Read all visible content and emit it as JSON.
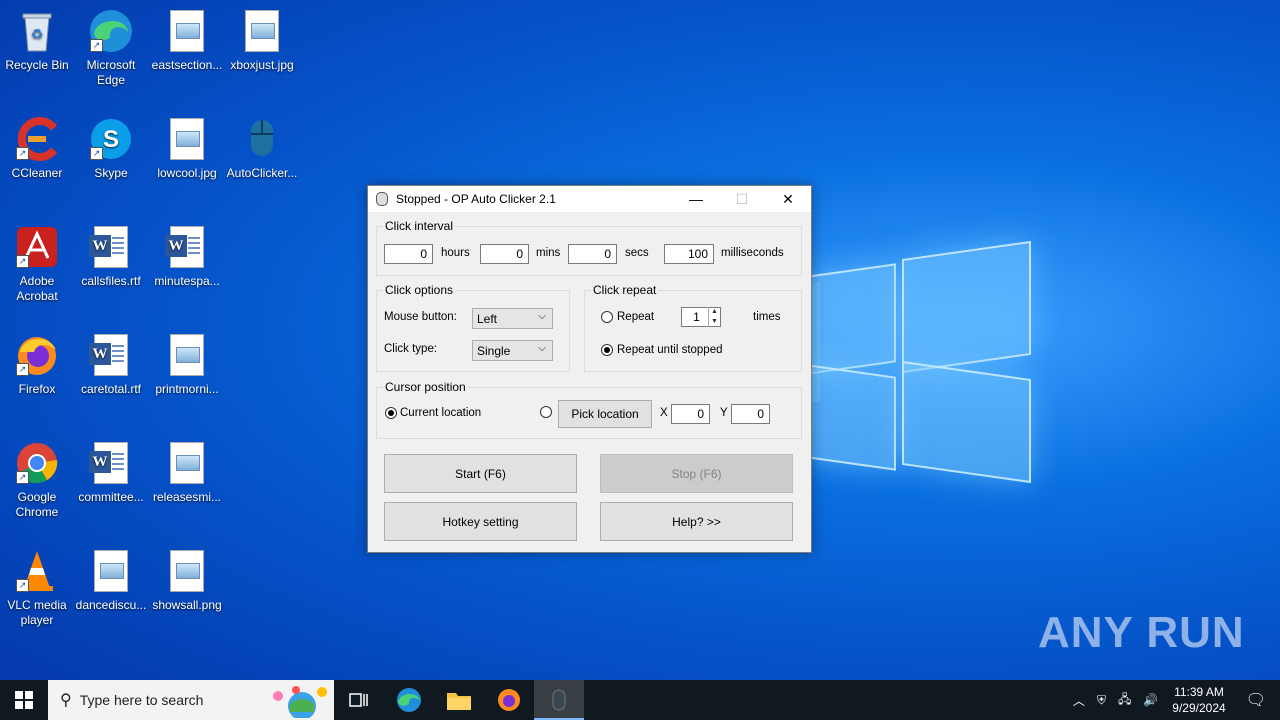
{
  "desktop": {
    "icons": [
      {
        "label": "Recycle Bin"
      },
      {
        "label": "Microsoft Edge"
      },
      {
        "label": "eastsection..."
      },
      {
        "label": "xboxjust.jpg"
      },
      {
        "label": "CCleaner"
      },
      {
        "label": "Skype"
      },
      {
        "label": "lowcool.jpg"
      },
      {
        "label": "AutoClicker..."
      },
      {
        "label": "Adobe Acrobat"
      },
      {
        "label": "callsfiles.rtf"
      },
      {
        "label": "minutespa..."
      },
      {
        "label": "Firefox"
      },
      {
        "label": "caretotal.rtf"
      },
      {
        "label": "printmorni..."
      },
      {
        "label": "Google Chrome"
      },
      {
        "label": "committee..."
      },
      {
        "label": "releasesmi..."
      },
      {
        "label": "VLC media player"
      },
      {
        "label": "dancediscu..."
      },
      {
        "label": "showsall.png"
      }
    ]
  },
  "window": {
    "title": "Stopped - OP Auto Clicker 2.1",
    "click_interval": {
      "label": "Click interval",
      "hours": "0",
      "hours_label": "hours",
      "mins": "0",
      "mins_label": "mins",
      "secs": "0",
      "secs_label": "secs",
      "ms": "100",
      "ms_label": "milliseconds"
    },
    "click_options": {
      "label": "Click options",
      "mouse_button_label": "Mouse button:",
      "mouse_button_value": "Left",
      "click_type_label": "Click type:",
      "click_type_value": "Single"
    },
    "click_repeat": {
      "label": "Click repeat",
      "repeat_label": "Repeat",
      "repeat_count": "1",
      "times_label": "times",
      "until_stopped_label": "Repeat until stopped",
      "selected": "until_stopped"
    },
    "cursor_position": {
      "label": "Cursor position",
      "current_label": "Current location",
      "pick_label": "Pick location",
      "x_label": "X",
      "x_value": "0",
      "y_label": "Y",
      "y_value": "0",
      "selected": "current"
    },
    "buttons": {
      "start": "Start (F6)",
      "stop": "Stop (F6)",
      "hotkey": "Hotkey setting",
      "help": "Help? >>"
    }
  },
  "taskbar": {
    "search_placeholder": "Type here to search",
    "time": "11:39 AM",
    "date": "9/29/2024"
  },
  "watermark": "ANY RUN"
}
